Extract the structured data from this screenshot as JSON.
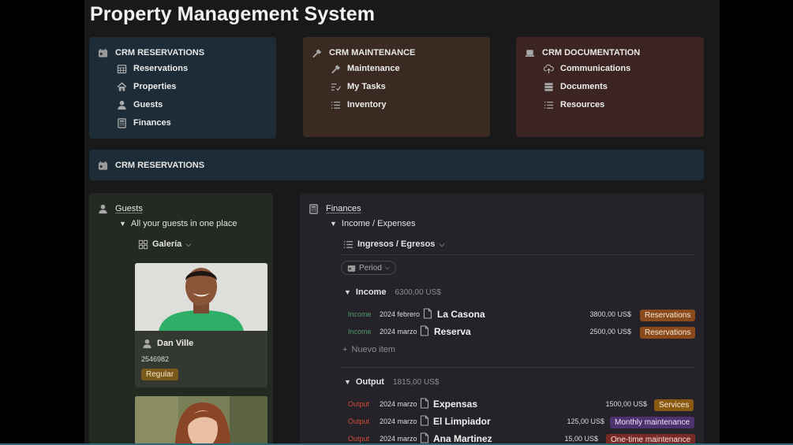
{
  "title": "Property Management System",
  "cards": [
    {
      "header": "CRM RESERVATIONS",
      "header_icon": "calendar-icon",
      "items": [
        {
          "label": "Reservations",
          "icon": "calendar-grid-icon"
        },
        {
          "label": "Properties",
          "icon": "house-icon"
        },
        {
          "label": "Guests",
          "icon": "person-icon"
        },
        {
          "label": "Finances",
          "icon": "calculator-icon"
        }
      ]
    },
    {
      "header": "CRM MAINTENANCE",
      "header_icon": "hammer-icon",
      "items": [
        {
          "label": "Maintenance",
          "icon": "hammer-icon"
        },
        {
          "label": "My Tasks",
          "icon": "checklist-icon"
        },
        {
          "label": "Inventory",
          "icon": "list-icon"
        }
      ]
    },
    {
      "header": "CRM DOCUMENTATION",
      "header_icon": "laptop-icon",
      "items": [
        {
          "label": "Communications",
          "icon": "cloud-upload-icon"
        },
        {
          "label": "Documents",
          "icon": "stack-icon"
        },
        {
          "label": "Resources",
          "icon": "list-icon"
        }
      ]
    }
  ],
  "section_bar": {
    "label": "CRM RESERVATIONS"
  },
  "guests": {
    "title": "Guests",
    "toggle": "All your guests in one place",
    "view": "Galería",
    "gallery": [
      {
        "name": "Dan Ville",
        "phone": "2546982",
        "tag": "Regular"
      }
    ]
  },
  "finances": {
    "title": "Finances",
    "toggle": "Income / Expenses",
    "view": "Ingresos / Egresos",
    "filter": "Period",
    "income": {
      "label": "Income",
      "total": "6300,00 US$",
      "rows": [
        {
          "kind": "Income",
          "date": "2024 febrero",
          "name": "La Casona",
          "amount": "3800,00 US$",
          "tag": "Reservations"
        },
        {
          "kind": "Income",
          "date": "2024 marzo",
          "name": "Reserva",
          "amount": "2500,00 US$",
          "tag": "Reservations"
        }
      ],
      "new_item": "Nuevo item"
    },
    "output": {
      "label": "Output",
      "total": "1815,00 US$",
      "rows": [
        {
          "kind": "Output",
          "date": "2024 marzo",
          "name": "Expensas",
          "amount": "1500,00 US$",
          "tag": "Services"
        },
        {
          "kind": "Output",
          "date": "2024 marzo",
          "name": "El Limpiador",
          "amount": "125,00 US$",
          "tag": "Monthly maintenance"
        },
        {
          "kind": "Output",
          "date": "2024 marzo",
          "name": "Ana Martinez",
          "amount": "15,00 US$",
          "tag": "One-time maintenance"
        }
      ]
    }
  },
  "colors": {
    "income_kind": "#4f9a6a",
    "output_kind": "#d04a3a",
    "reservations_tag": "#8a4a1c",
    "services_tag": "#8a5a12",
    "monthly_tag": "#4e3270",
    "one_time_tag": "#7a2a24"
  }
}
